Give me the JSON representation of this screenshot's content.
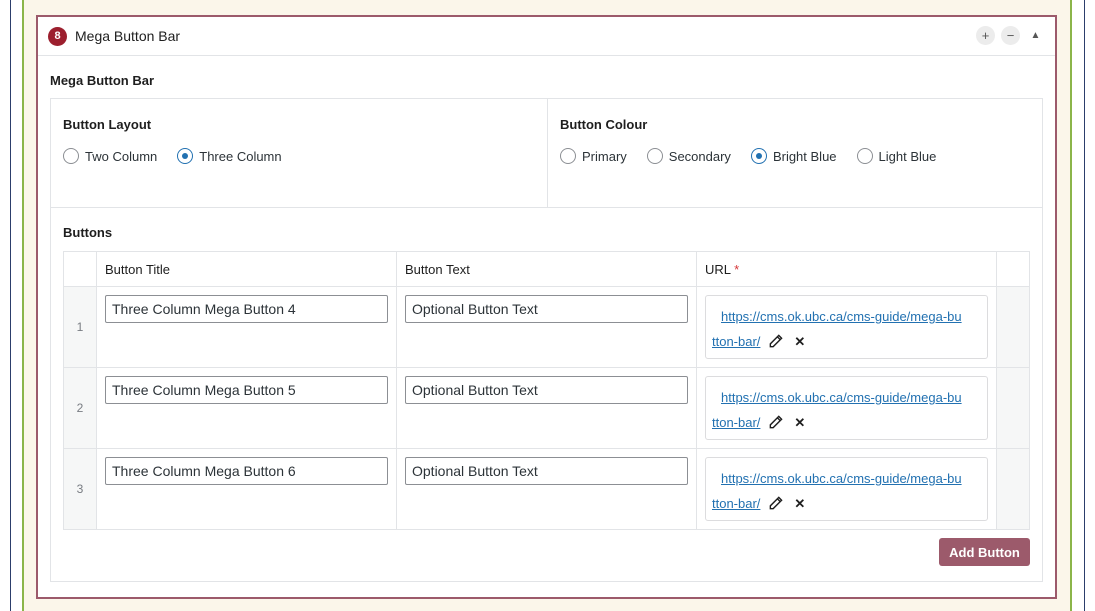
{
  "layout": {
    "number": "8",
    "title": "Mega Button Bar",
    "controls": {
      "add": "+",
      "remove": "−",
      "collapse": "▲"
    }
  },
  "field": {
    "label": "Mega Button Bar",
    "button_layout": {
      "label": "Button Layout",
      "options": [
        "Two Column",
        "Three Column"
      ],
      "selected": "Three Column"
    },
    "button_colour": {
      "label": "Button Colour",
      "options": [
        "Primary",
        "Secondary",
        "Bright Blue",
        "Light Blue"
      ],
      "selected": "Bright Blue"
    },
    "buttons": {
      "label": "Buttons",
      "columns": [
        "Button Title",
        "Button Text",
        "URL"
      ],
      "required_mark": "*",
      "rows": [
        {
          "num": "1",
          "title": "Three Column Mega Button 4",
          "text": "Optional Button Text",
          "url_line1": "https://cms.ok.ubc.ca/cms-guide/mega-bu",
          "url_line2": "tton-bar/"
        },
        {
          "num": "2",
          "title": "Three Column Mega Button 5",
          "text": "Optional Button Text",
          "url_line1": "https://cms.ok.ubc.ca/cms-guide/mega-bu",
          "url_line2": "tton-bar/"
        },
        {
          "num": "3",
          "title": "Three Column Mega Button 6",
          "text": "Optional Button Text",
          "url_line1": "https://cms.ok.ubc.ca/cms-guide/mega-bu",
          "url_line2": "tton-bar/"
        }
      ],
      "add_label": "Add Button"
    }
  },
  "colors": {
    "accent": "#9c5a6b",
    "badge": "#9c1f2e",
    "link": "#2271b1",
    "green_border": "#8bb54a",
    "background": "#fbf6ea"
  },
  "icons": {
    "edit": "pencil-icon",
    "remove": "close-icon"
  }
}
